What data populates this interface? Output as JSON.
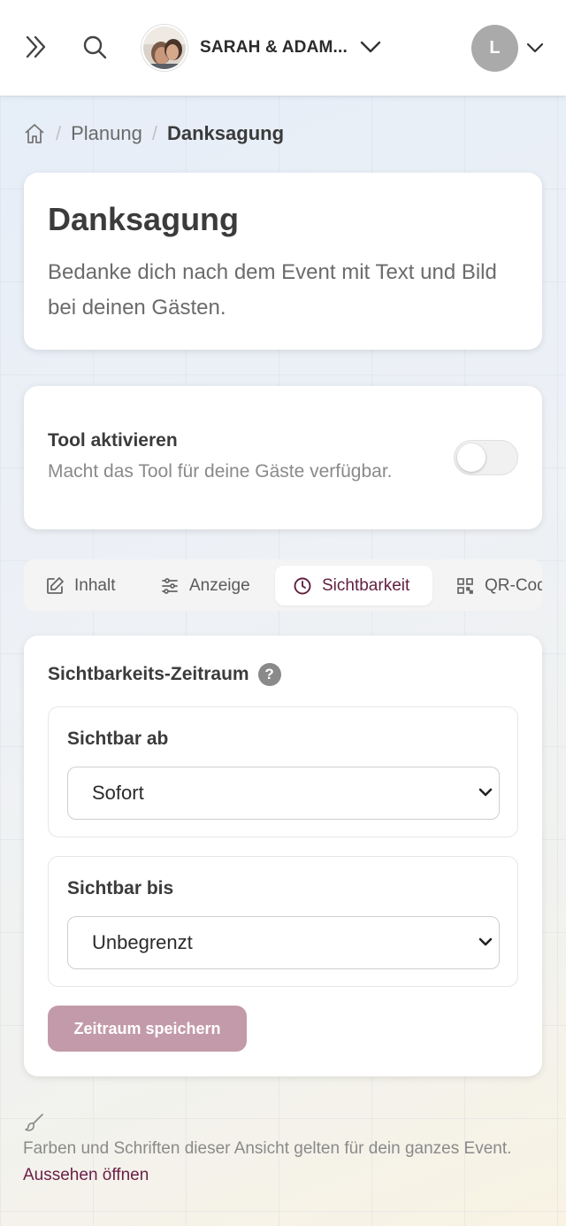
{
  "header": {
    "event_name": "SARAH & ADAM...",
    "user_initial": "L",
    "icons": [
      "collapse-sidebar-icon",
      "search-icon",
      "chevron-down-icon"
    ]
  },
  "breadcrumb": {
    "items": [
      "Planung",
      "Danksagung"
    ]
  },
  "intro": {
    "title": "Danksagung",
    "description": "Bedanke dich nach dem Event mit Text und Bild bei deinen Gästen."
  },
  "tool": {
    "title": "Tool aktivieren",
    "description": "Macht das Tool für deine Gäste verfügbar.",
    "enabled": false
  },
  "tabs": [
    {
      "label": "Inhalt",
      "icon": "edit-icon",
      "active": false
    },
    {
      "label": "Anzeige",
      "icon": "sliders-icon",
      "active": false
    },
    {
      "label": "Sichtbarkeit",
      "icon": "clock-icon",
      "active": true
    },
    {
      "label": "QR-Cod",
      "icon": "qr-code-icon",
      "active": false
    }
  ],
  "visibility": {
    "title": "Sichtbarkeits-Zeitraum",
    "help": "?",
    "from_label": "Sichtbar ab",
    "from_value": "Sofort",
    "to_label": "Sichtbar bis",
    "to_value": "Unbegrenzt",
    "save_label": "Zeitraum speichern"
  },
  "footer": {
    "text": "Farben und Schriften dieser Ansicht gelten für dein ganzes Event.",
    "link": "Aussehen öffnen"
  },
  "colors": {
    "accent": "#6b1e45",
    "button_disabled": "#c39aa9"
  }
}
